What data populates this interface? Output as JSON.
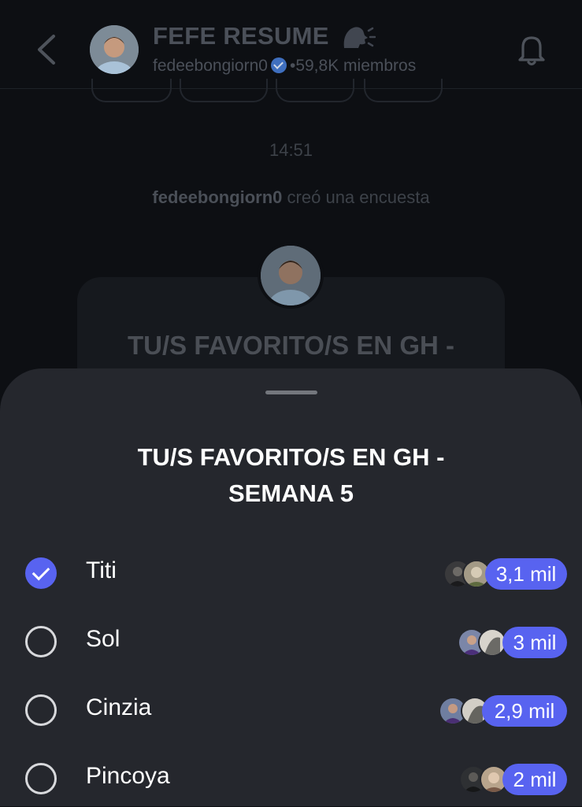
{
  "header": {
    "title": "FEFE RESUME",
    "username": "fedeebongiorn0",
    "separator": "•",
    "members": "59,8K miembros"
  },
  "chat": {
    "time": "14:51",
    "event_user": "fedeebongiorn0",
    "event_text": "creó una encuesta",
    "poll_title_preview": "TU/S FAVORITO/S EN GH -"
  },
  "poll": {
    "title_line1": "TU/S FAVORITO/S EN GH -",
    "title_line2": "SEMANA 5",
    "options": [
      {
        "label": "Titi",
        "count": "3,1 mil",
        "selected": true
      },
      {
        "label": "Sol",
        "count": "3 mil",
        "selected": false
      },
      {
        "label": "Cinzia",
        "count": "2,9 mil",
        "selected": false
      },
      {
        "label": "Pincoya",
        "count": "2 mil",
        "selected": false
      }
    ]
  },
  "colors": {
    "accent": "#5863f0",
    "sheet": "#25272d",
    "background": "#0d0f13"
  },
  "icons": [
    "back-chevron-icon",
    "speaking-head-icon",
    "verified-badge-icon",
    "bell-icon",
    "checkmark-icon"
  ]
}
